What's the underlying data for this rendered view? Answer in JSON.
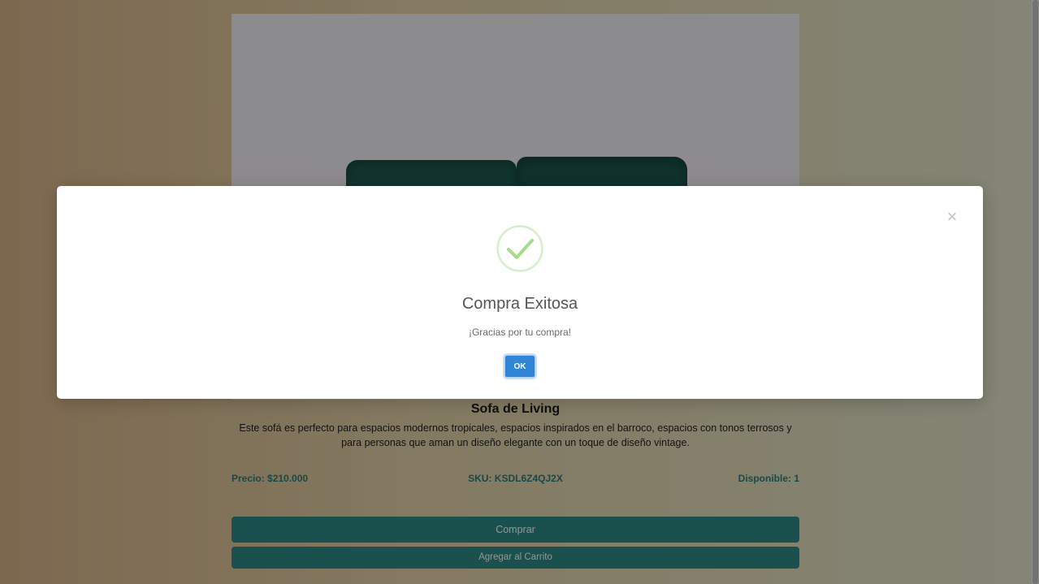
{
  "product": {
    "title": "Sofa de Living",
    "description": "Este sofá es perfecto para espacios modernos tropicales, espacios inspirados en el barroco, espacios con tonos terrosos y para personas que aman un diseño elegante con un toque de diseño vintage.",
    "price_label": "Precio: $210.000",
    "sku_label": "SKU: KSDL6Z4QJ2X",
    "stock_label": "Disponible: 1",
    "image_icon": "sofa-image"
  },
  "actions": {
    "buy_label": "Comprar",
    "add_to_cart_label": "Agregar al Carrito"
  },
  "modal": {
    "close_symbol": "×",
    "icon": "success-check-icon",
    "title": "Compra Exitosa",
    "text": "¡Gracias por tu compra!",
    "ok_label": "OK"
  },
  "colors": {
    "accent": "#2e8a85",
    "success": "#a5dc86",
    "confirm": "#3085d6"
  }
}
